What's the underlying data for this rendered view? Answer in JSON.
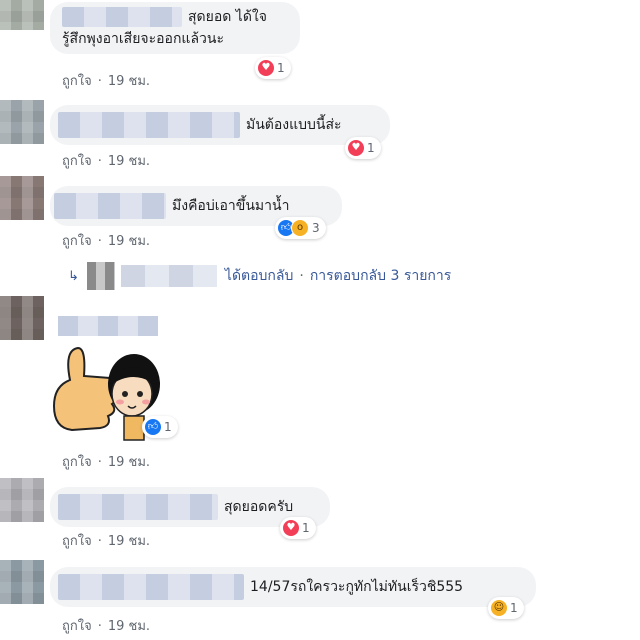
{
  "comments": [
    {
      "text_line1": "สุดยอด ได้ใจ",
      "text_line2": "รู้สึกพุงอาเสียจะออกแล้วนะ",
      "like": "ถูกใจ",
      "time": "19 ชม.",
      "reaction": {
        "icon": "heart-icon",
        "count": "1"
      }
    },
    {
      "text": "มันต้องแบบนี้ส่ะ",
      "like": "ถูกใจ",
      "time": "19 ชม.",
      "reaction": {
        "icon": "heart-icon",
        "count": "1"
      }
    },
    {
      "text": "มึงคือบ่เอาขึ้นมาน้ำ",
      "like": "ถูกใจ",
      "time": "19 ชม.",
      "reaction": {
        "icons": [
          "like-icon",
          "wow-icon"
        ],
        "count": "3"
      }
    },
    {
      "sticker": "thumbs-up-girl-sticker",
      "like": "ถูกใจ",
      "time": "19 ชม.",
      "reaction": {
        "icon": "like-icon",
        "count": "1"
      }
    },
    {
      "text": "สุดยอดครับ",
      "like": "ถูกใจ",
      "time": "19 ชม.",
      "reaction": {
        "icon": "heart-icon",
        "count": "1"
      }
    },
    {
      "text": "14/57รถใครวะกูทักไม่ทันเร็วชิ555",
      "like": "ถูกใจ",
      "time": "19 ชม.",
      "reaction": {
        "icon": "haha-icon",
        "count": "1"
      }
    }
  ],
  "reply": {
    "replied": "ได้ตอบกลับ",
    "separator": "·",
    "count_text": "การตอบกลับ 3 รายการ"
  },
  "colors": {
    "heart": "#f33e58",
    "like": "#1877f2",
    "link": "#385898",
    "bubble": "#f2f3f5"
  }
}
